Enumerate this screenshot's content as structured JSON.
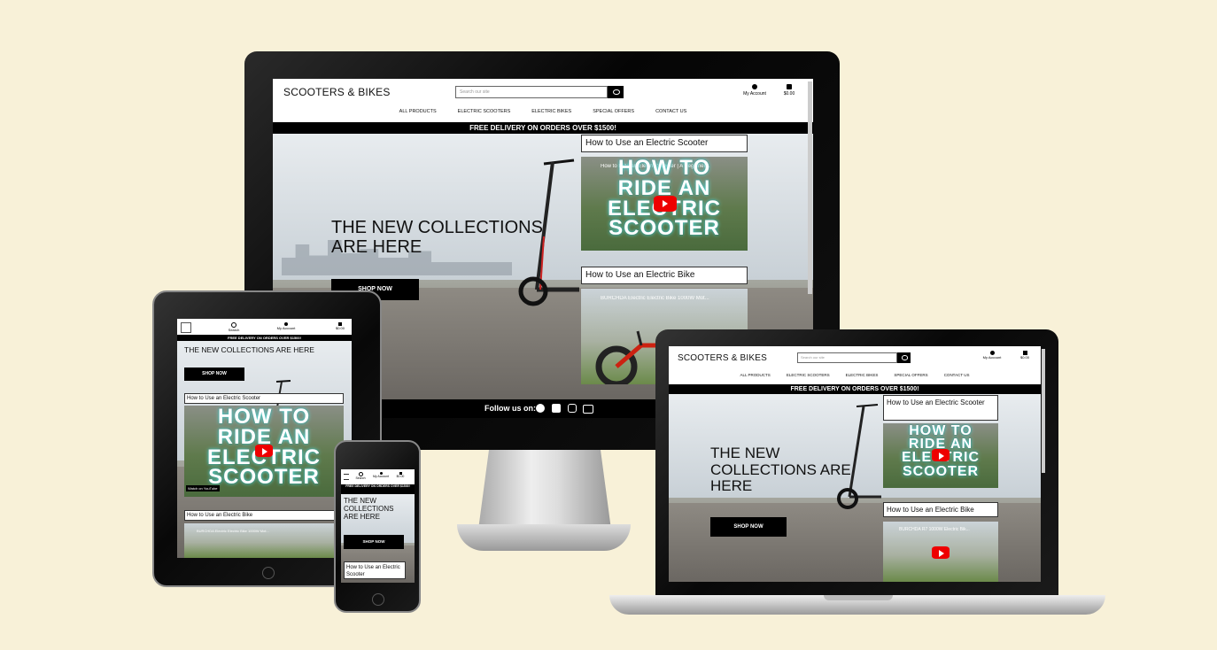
{
  "site": {
    "logo": "SCOOTERS & BIKES",
    "search_placeholder": "Search our site",
    "account_label": "My Account",
    "search_label": "Search",
    "cart_total": "$0.00",
    "nav": [
      "ALL PRODUCTS",
      "ELECTRIC SCOOTERS",
      "ELECTRIC BIKES",
      "SPECIAL OFFERS",
      "CONTACT US"
    ],
    "banner": "FREE DELIVERY ON ORDERS OVER $1500!",
    "hero_title": "THE NEW COLLECTIONS ARE HERE",
    "tablet_hero_title": "THE NEW COLLECTIONS ARE HERE",
    "hero_line1": "THE NEW COLLECTIONS",
    "hero_line2": "ARE HERE",
    "laptop_line1": "THE NEW",
    "laptop_line2": "COLLECTIONS ARE",
    "laptop_line3": "HERE",
    "phone_line1": "THE NEW",
    "phone_line2": "COLLECTIONS",
    "phone_line3": "ARE HERE",
    "shop_now": "SHOP NOW",
    "video1_label": "How to Use an Electric Scooter",
    "video2_label": "How to Use an Electric Bike",
    "video1_title": "How to Ride an Electric Scooter | A Beginner...",
    "video2_title": "BURCHDA Electric Electric Bike 1000W Mot...",
    "laptop_video2_title": "BURCHDA R7 1000W Electric Bik...",
    "video_text_1": "HOW TO",
    "video_text_2": "RIDE AN",
    "video_text_3": "ELECTRIC",
    "video_text_4": "SCOOTER",
    "watch_on": "Watch on",
    "youtube": "YouTube",
    "follow_us": "Follow us on:",
    "phone_banner": "FREE DELIVERY ON ORDERS OVER $1500!",
    "phone_video_label": "How to Use an Electric Scooter"
  },
  "colors": {
    "background": "#f8f1d8",
    "banner": "#000000",
    "play": "#e00000"
  },
  "icons": [
    "search-icon",
    "account-icon",
    "cart-icon",
    "hamburger-icon",
    "github-icon",
    "facebook-icon",
    "instagram-icon",
    "youtube-icon",
    "play-icon"
  ]
}
